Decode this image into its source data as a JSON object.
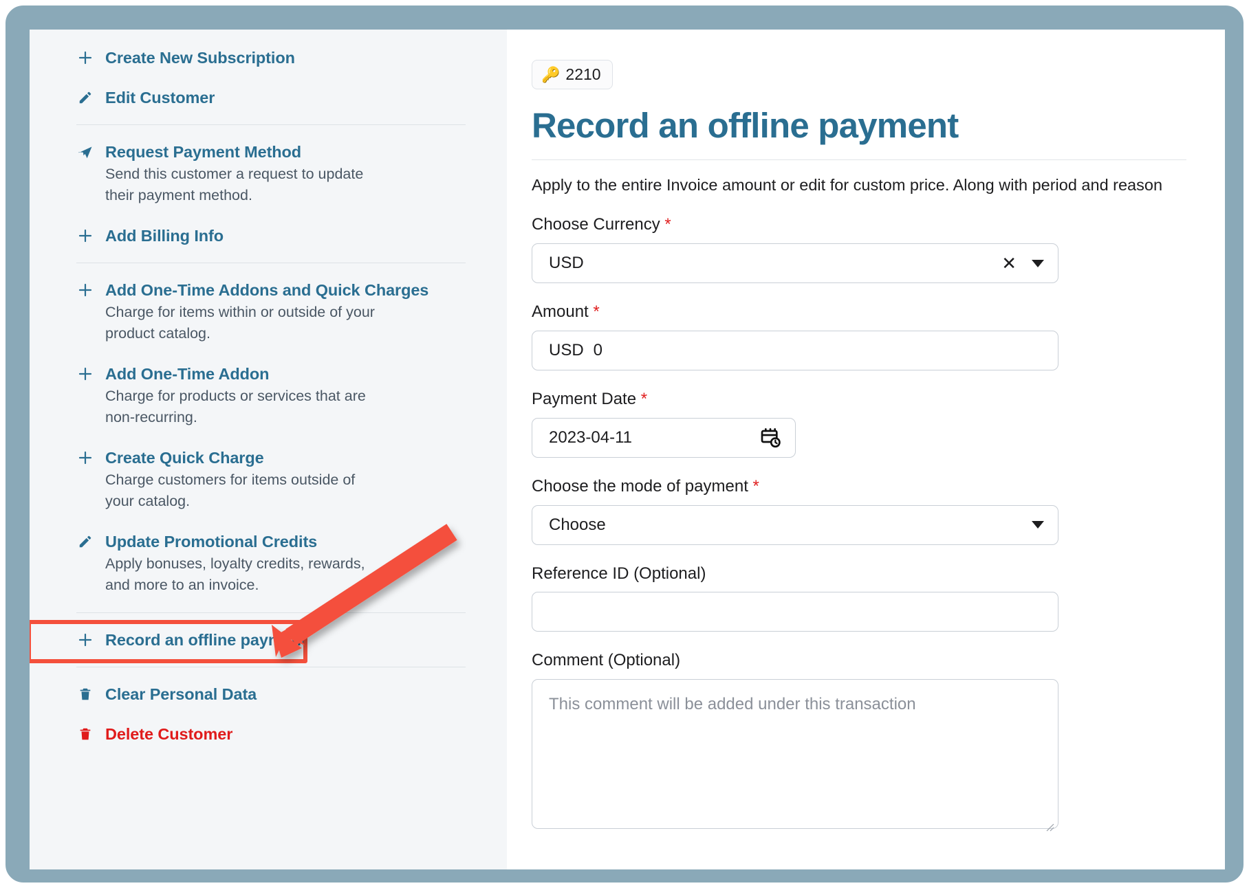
{
  "sidebar": {
    "items": [
      {
        "icon": "plus-icon",
        "label": "Create New Subscription",
        "desc": "",
        "danger": false
      },
      {
        "icon": "pencil-icon",
        "label": "Edit Customer",
        "desc": "",
        "danger": false
      },
      {
        "icon": "send-icon",
        "label": "Request Payment Method",
        "desc": "Send this customer a request to update their payment method.",
        "danger": false
      },
      {
        "icon": "plus-icon",
        "label": "Add Billing Info",
        "desc": "",
        "danger": false
      },
      {
        "icon": "plus-icon",
        "label": "Add One-Time Addons and Quick Charges",
        "desc": "Charge for items within or outside of your product catalog.",
        "danger": false
      },
      {
        "icon": "plus-icon",
        "label": "Add One-Time Addon",
        "desc": "Charge for products or services that are non-recurring.",
        "danger": false
      },
      {
        "icon": "plus-icon",
        "label": "Create Quick Charge",
        "desc": "Charge customers for items outside of your catalog.",
        "danger": false
      },
      {
        "icon": "pencil-icon",
        "label": "Update Promotional Credits",
        "desc": "Apply bonuses, loyalty credits, rewards, and more to an invoice.",
        "danger": false
      },
      {
        "icon": "plus-icon",
        "label": "Record an offline payment",
        "desc": "",
        "danger": false
      },
      {
        "icon": "trash-icon",
        "label": "Clear Personal Data",
        "desc": "",
        "danger": false
      },
      {
        "icon": "trash-icon",
        "label": "Delete Customer",
        "desc": "",
        "danger": true
      }
    ]
  },
  "main": {
    "badge": {
      "icon": "key-icon",
      "glyph": "🔑",
      "value": "2210"
    },
    "title": "Record an offline payment",
    "subtext": "Apply to the entire Invoice amount or edit for custom price. Along with period and reason",
    "fields": {
      "currency": {
        "label": "Choose Currency",
        "required": "*",
        "value": "USD",
        "clear_icon": "✕",
        "chevron_icon": "chevron-down-icon"
      },
      "amount": {
        "label": "Amount",
        "required": "*",
        "currency_prefix": "USD",
        "value": "0"
      },
      "payment_date": {
        "label": "Payment Date",
        "required": "*",
        "value": "2023-04-11",
        "icon": "calendar-clock-icon"
      },
      "mode_of_payment": {
        "label": "Choose the mode of payment",
        "required": "*",
        "value": "Choose",
        "chevron_icon": "chevron-down-icon"
      },
      "reference_id": {
        "label": "Reference ID (Optional)",
        "value": "",
        "placeholder": ""
      },
      "comment": {
        "label": "Comment (Optional)",
        "value": "",
        "placeholder": "This comment will be added under this transaction"
      }
    }
  },
  "annotation": {
    "highlight_target": "Record an offline payment",
    "highlight_color": "#f4503c",
    "arrow_color": "#f4503c"
  },
  "colors": {
    "link": "#2a6e91",
    "danger": "#e01b1b",
    "frame": "#8aa9b8",
    "sidebar_bg": "#f4f6f8",
    "border": "#c9cfd6"
  }
}
